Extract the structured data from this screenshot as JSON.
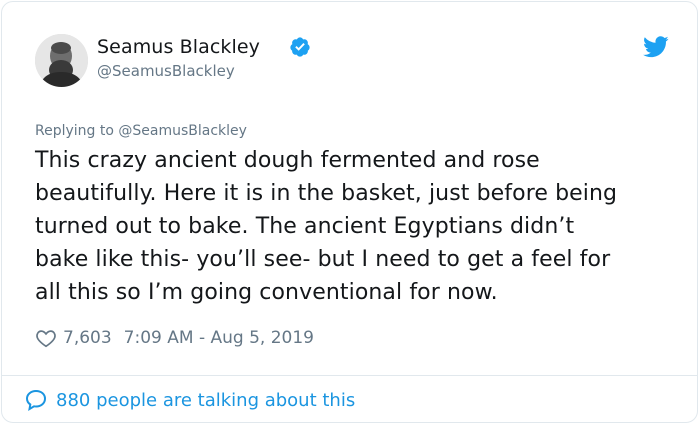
{
  "user": {
    "name": "Seamus Blackley",
    "handle": "@SeamusBlackley",
    "verified": true
  },
  "tweet": {
    "replying_to_label": "Replying to",
    "replying_to_handle": "@SeamusBlackley",
    "lines": [
      "This crazy ancient dough fermented and rose",
      "beautifully. Here it is in the basket, just before being",
      "turned out to bake. The ancient Egyptians didn’t",
      "bake like this- you’ll see- but I need to get a feel for",
      "all this so I’m going conventional for now."
    ],
    "likes": "7,603",
    "timestamp": "7:09 AM - Aug 5, 2019"
  },
  "footer": {
    "talking": "880 people are talking about this"
  },
  "icons": {
    "verified": "verified-badge-icon",
    "brand": "twitter-bird-icon",
    "like": "heart-outline-icon",
    "reply": "speech-bubble-icon"
  },
  "colors": {
    "accent": "#1da1f2",
    "link": "#1b95e0",
    "muted": "#657786",
    "text": "#14171a",
    "border": "#e1e8ed"
  }
}
